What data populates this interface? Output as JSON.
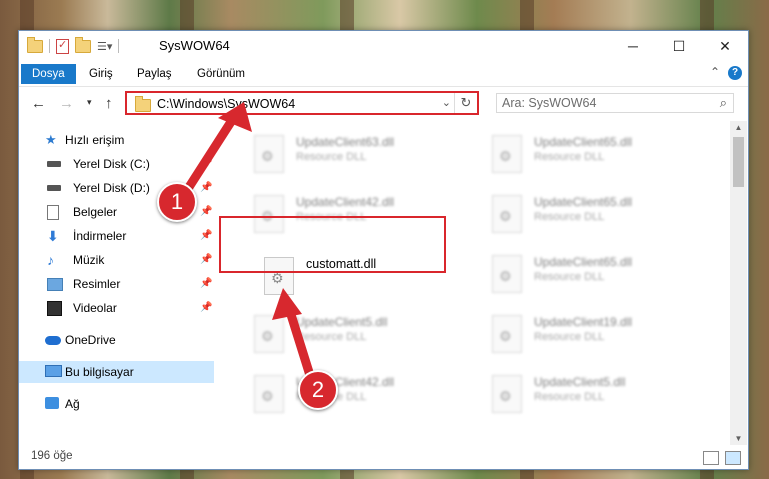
{
  "window": {
    "title": "SysWOW64"
  },
  "ribbon": {
    "tabs": [
      "Dosya",
      "Giriş",
      "Paylaş",
      "Görünüm"
    ],
    "help_icon": "?"
  },
  "address": {
    "path": "C:\\Windows\\SysWOW64",
    "search_placeholder": "Ara: SysWOW64"
  },
  "sidebar": {
    "quick_access": "Hızlı erişim",
    "items": [
      {
        "label": "Yerel Disk (C:)",
        "icon": "drive-icon"
      },
      {
        "label": "Yerel Disk (D:)",
        "icon": "drive-icon"
      },
      {
        "label": "Belgeler",
        "icon": "documents-icon"
      },
      {
        "label": "İndirmeler",
        "icon": "downloads-icon"
      },
      {
        "label": "Müzik",
        "icon": "music-icon"
      },
      {
        "label": "Resimler",
        "icon": "pictures-icon"
      },
      {
        "label": "Videolar",
        "icon": "videos-icon"
      }
    ],
    "onedrive": "OneDrive",
    "this_pc": "Bu bilgisayar",
    "network": "Ağ"
  },
  "files": {
    "col1": [
      {
        "name": "UpdateClient63.dll",
        "type": "Resource DLL"
      },
      {
        "name": "UpdateClient42.dll",
        "type": "Resource DLL"
      },
      {
        "name": "customatt.dll",
        "type": ""
      },
      {
        "name": "UpdateClient5.dll",
        "type": "Resource DLL"
      },
      {
        "name": "UpdateClient42.dll",
        "type": "Resource DLL"
      }
    ],
    "col2": [
      {
        "name": "UpdateClient65.dll",
        "type": "Resource DLL"
      },
      {
        "name": "UpdateClient65.dll",
        "type": "Resource DLL"
      },
      {
        "name": "UpdateClient65.dll",
        "type": "Resource DLL"
      },
      {
        "name": "UpdateClient19.dll",
        "type": "Resource DLL"
      },
      {
        "name": "UpdateClient5.dll",
        "type": "Resource DLL"
      }
    ]
  },
  "status": {
    "item_count": "196 öğe"
  },
  "annotations": {
    "step1": "1",
    "step2": "2",
    "color": "#d7282e"
  }
}
